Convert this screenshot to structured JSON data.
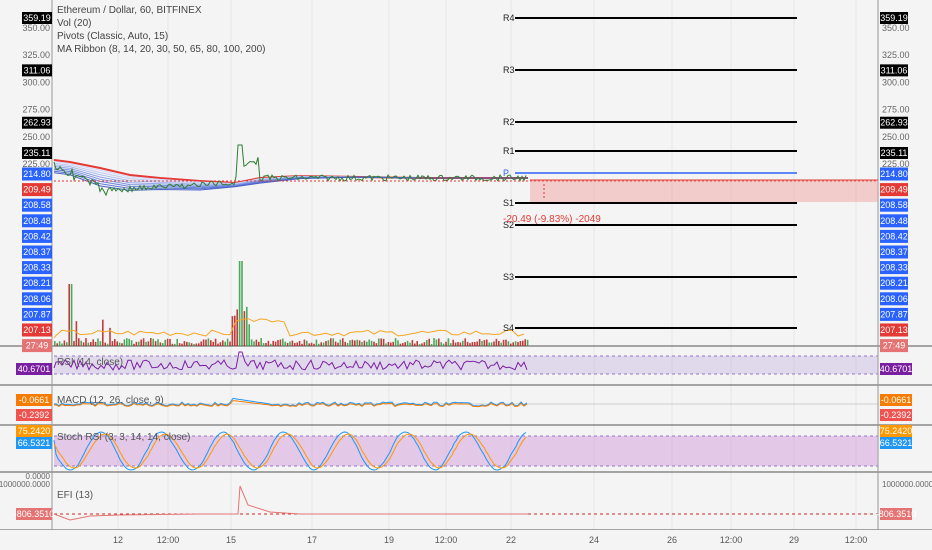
{
  "chart_data": {
    "type": "line",
    "main": {
      "title": "Ethereum / Dollar, 60, BITFINEX",
      "indicators": [
        "Vol (20)",
        "Pivots (Classic, Auto, 15)",
        "MA Ribbon (8, 14, 20, 30, 50, 65, 80, 100, 200)"
      ],
      "price_axis": {
        "ticks": [
          "350.00",
          "325.00",
          "300.00",
          "275.00",
          "250.00",
          "225.00"
        ],
        "badges": [
          {
            "label": "359.19",
            "value": 359.19,
            "color": "#000000"
          },
          {
            "label": "311.06",
            "value": 311.06,
            "color": "#000000"
          },
          {
            "label": "262.93",
            "value": 262.93,
            "color": "#000000"
          },
          {
            "label": "235.11",
            "value": 235.11,
            "color": "#000000"
          }
        ],
        "ma_badges_blue": [
          "214.80",
          "208.58",
          "208.48",
          "208.42",
          "208.37",
          "208.33",
          "208.21",
          "208.06",
          "207.87"
        ],
        "ma_badges_red": [
          "209.49",
          "207.13",
          "27:49"
        ]
      },
      "pivots": [
        {
          "label": "R4",
          "value": 359.19
        },
        {
          "label": "R3",
          "value": 311.06
        },
        {
          "label": "R2",
          "value": 262.93
        },
        {
          "label": "R1",
          "value": 235.11
        },
        {
          "label": "P",
          "value": 214.8
        },
        {
          "label": "S1",
          "value": 186.8
        },
        {
          "label": "S2",
          "value": 166.9
        },
        {
          "label": "S3",
          "value": 119.0
        },
        {
          "label": "S4",
          "value": 71.0
        }
      ],
      "last_price": 209.49,
      "projection_label": "-20.49 (-9.83%) -2049"
    },
    "panes": [
      {
        "name": "RSI (14, close)",
        "value": "40.6701",
        "color": "#7b1fa2"
      },
      {
        "name": "MACD (12, 26, close, 9)",
        "values": [
          "-0.0661",
          "-0.2392"
        ],
        "colors": [
          "#f57c00",
          "#ef5350"
        ]
      },
      {
        "name": "Stoch RSI (3, 3, 14, 14, close)",
        "values": [
          "75.2420",
          "66.5321"
        ],
        "colors": [
          "#ff9800",
          "#2196f3"
        ],
        "left_tick": "0.0000"
      },
      {
        "name": "EFI (13)",
        "value": "-806.3510",
        "color": "#e57373",
        "left_tick": "1000000.0000"
      }
    ],
    "x_ticks": [
      "12",
      "12:00",
      "15",
      "17",
      "19",
      "12:00",
      "22",
      "24",
      "26",
      "12:00",
      "29",
      "12:00"
    ]
  }
}
